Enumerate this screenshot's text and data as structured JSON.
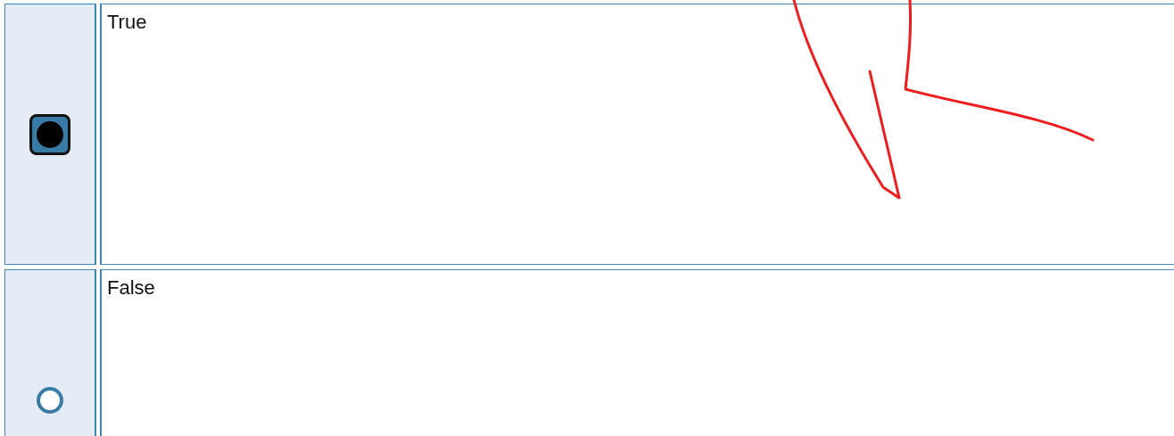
{
  "options": [
    {
      "label": "True",
      "selected": true
    },
    {
      "label": "False",
      "selected": false
    }
  ]
}
